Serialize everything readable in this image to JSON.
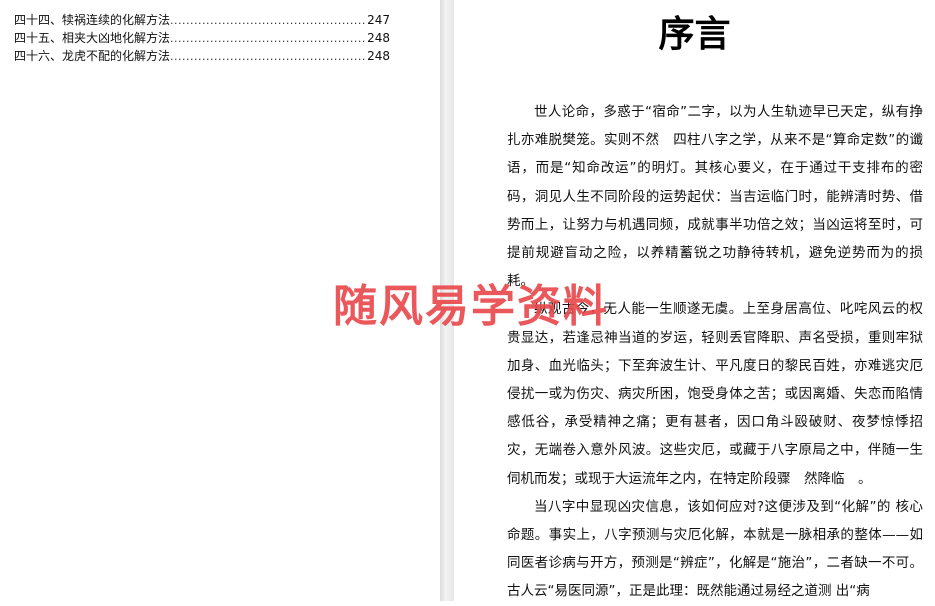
{
  "toc": [
    {
      "title": "四十四、犊祸连续的化解方法",
      "page": "247"
    },
    {
      "title": "四十五、相夹大凶地化解方法",
      "page": "248"
    },
    {
      "title": "四十六、龙虎不配的化解方法",
      "page": "248"
    }
  ],
  "preface": {
    "title": "序言",
    "paragraphs": [
      "世人论命，多惑于“宿命”二字，以为人生轨迹早已天定，纵有挣扎亦难脱樊笼。实则不然　四柱八字之学，从来不是“算命定数”的谶语，而是“知命改运”的明灯。其核心要义，在于通过干支排布的密码，洞见人生不同阶段的运势起伏：当吉运临门时，能辨清时势、借势而上，让努力与机遇同频，成就事半功倍之效；当凶运将至时，可提前规避盲动之险，以养精蓄锐之功静待转机，避免逆势而为的损耗。",
      "纵观古今，无人能一生顺遂无虞。上至身居高位、叱咤风云的权贵显达，若逢忌神当道的岁运，轻则丢官降职、声名受损，重则牢狱加身、血光临头；下至奔波生计、平凡度日的黎民百姓，亦难逃灾厄侵扰一或为伤灾、病灾所困，饱受身体之苦；或因离婚、失恋而陷情感低谷，承受精神之痛；更有甚者，因口角斗殴破财、夜梦惊悸招灾，无端卷入意外风波。这些灾厄，或藏于八字原局之中，伴随一生伺机而发；或现于大运流年之内，在特定阶段骤　然降临　。",
      "当八字中显现凶灾信息，该如何应对?这便涉及到“化解”的 核心命题。事实上，八字预测与灾厄化解，本就是一脉相承的整体——如同医者诊病与开方，预测是“辨症”，化解是“施治”，二者缺一不可。古人云“易医同源”，正是此理：既然能通过易经之道测 出“病"
    ]
  },
  "watermark": "随风易学资料"
}
